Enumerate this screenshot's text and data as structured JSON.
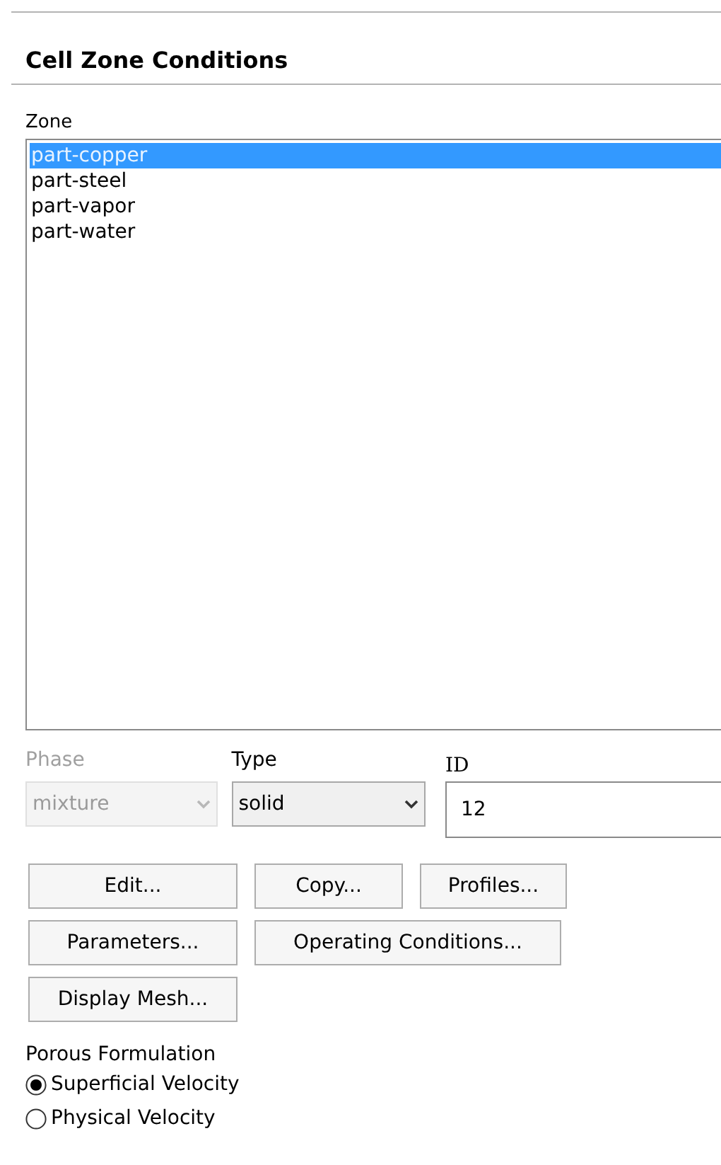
{
  "title": "Cell Zone Conditions",
  "zone": {
    "label": "Zone",
    "items": [
      {
        "label": "part-copper",
        "selected": true
      },
      {
        "label": "part-steel",
        "selected": false
      },
      {
        "label": "part-vapor",
        "selected": false
      },
      {
        "label": "part-water",
        "selected": false
      }
    ]
  },
  "phase": {
    "label": "Phase",
    "value": "mixture",
    "disabled": true
  },
  "type": {
    "label": "Type",
    "value": "solid",
    "disabled": false
  },
  "id": {
    "label": "ID",
    "value": "12"
  },
  "buttons": [
    [
      "Edit...",
      "Copy...",
      "Profiles..."
    ],
    [
      "Parameters...",
      "Operating Conditions..."
    ],
    [
      "Display Mesh..."
    ]
  ],
  "porous": {
    "label": "Porous Formulation",
    "options": [
      {
        "label": "Superficial Velocity",
        "selected": true
      },
      {
        "label": "Physical Velocity",
        "selected": false
      }
    ]
  }
}
